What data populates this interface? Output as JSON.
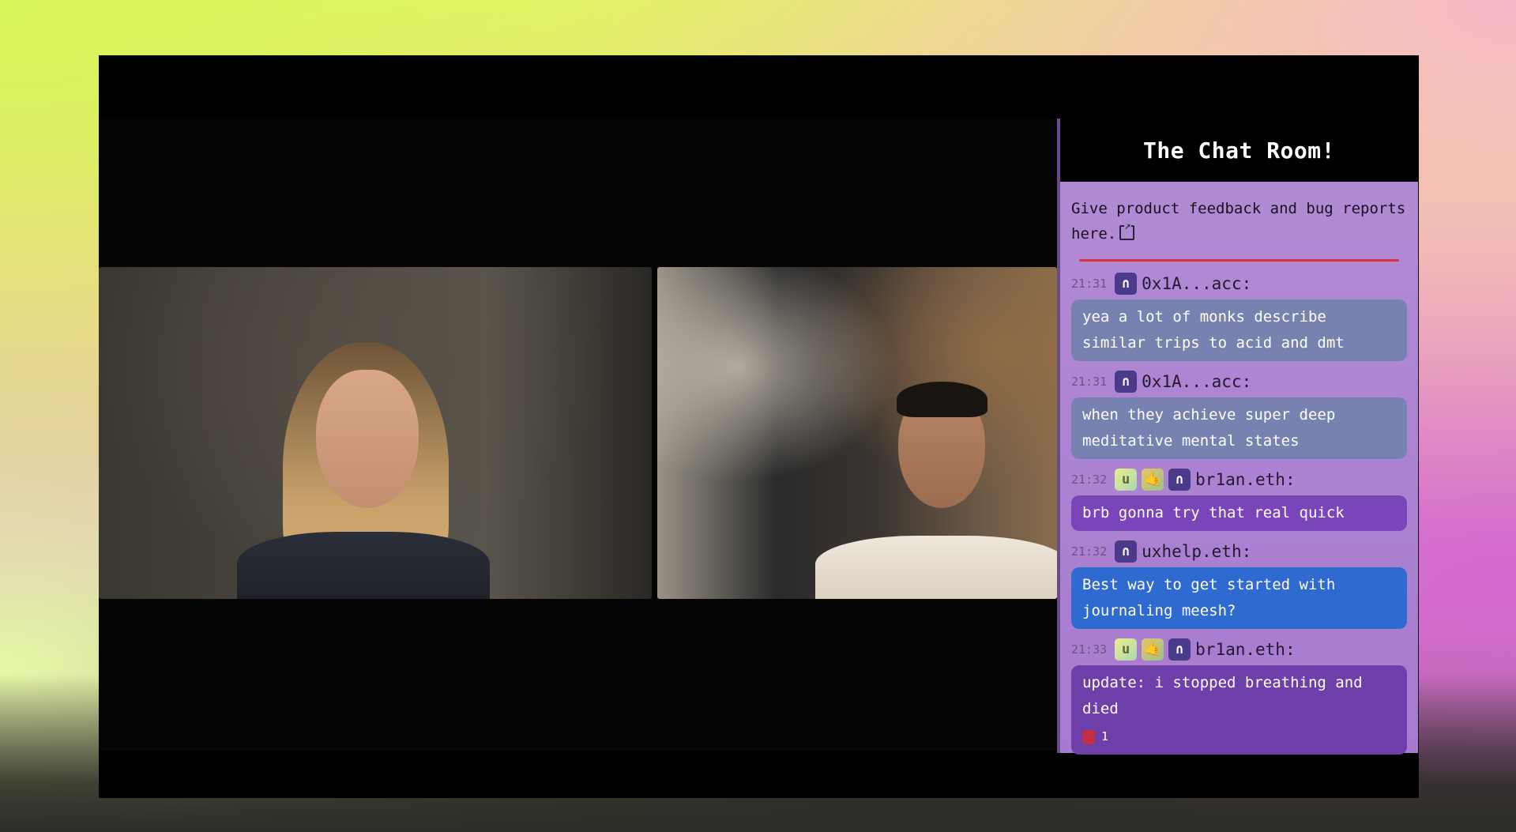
{
  "chat": {
    "title": "The Chat Room!",
    "feedback_text": "Give product feedback and bug reports here.",
    "messages": [
      {
        "time": "21:31",
        "user": "0x1A...acc:",
        "text": "yea a lot of monks describe similar trips to acid and dmt",
        "badges": [
          "n"
        ]
      },
      {
        "time": "21:31",
        "user": "0x1A...acc:",
        "text": "when they achieve super deep meditative mental states",
        "badges": [
          "n"
        ]
      },
      {
        "time": "21:32",
        "user": "br1an.eth:",
        "text": "brb gonna try that real quick",
        "badges": [
          "u",
          "t",
          "n"
        ]
      },
      {
        "time": "21:32",
        "user": "uxhelp.eth:",
        "text": "Best way to get started with journaling meesh?",
        "badges": [
          "n"
        ]
      },
      {
        "time": "21:33",
        "user": "br1an.eth:",
        "text": "update: i stopped breathing and died",
        "badges": [
          "u",
          "t",
          "n"
        ],
        "reaction_count": "1"
      }
    ],
    "badge_letters": {
      "u": "u",
      "t": "🤙",
      "n": "∩"
    }
  },
  "colors": {
    "chat_bg": "#a77bd0",
    "header_bg": "#000000",
    "divider": "#d8323a",
    "highlight_bubble": "#2f6ad0"
  }
}
